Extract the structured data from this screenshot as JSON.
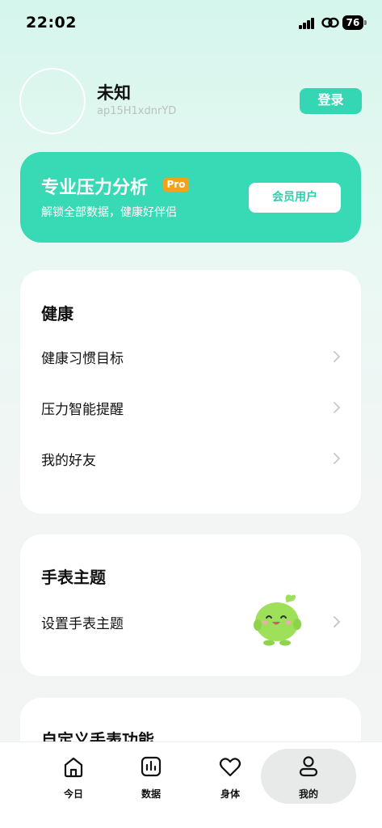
{
  "status_bar": {
    "time": "22:02",
    "battery": "76"
  },
  "profile": {
    "name": "未知",
    "user_id": "ap15H1xdnrYD",
    "login_label": "登录"
  },
  "pro_banner": {
    "title": "专业压力分析",
    "badge": "Pro",
    "subtitle": "解锁全部数据，健康好伴侣",
    "button_label": "会员用户"
  },
  "health_card": {
    "title": "健康",
    "items": [
      {
        "label": "健康习惯目标"
      },
      {
        "label": "压力智能提醒"
      },
      {
        "label": "我的好友"
      }
    ]
  },
  "watch_theme_card": {
    "title": "手表主题",
    "items": [
      {
        "label": "设置手表主题"
      }
    ]
  },
  "custom_card": {
    "title": "自定义手表功能"
  },
  "tab_bar": {
    "tabs": [
      {
        "label": "今日",
        "icon": "home-icon"
      },
      {
        "label": "数据",
        "icon": "chart-icon"
      },
      {
        "label": "身体",
        "icon": "heart-icon"
      },
      {
        "label": "我的",
        "icon": "person-icon"
      }
    ],
    "active": "我的"
  },
  "colors": {
    "accent": "#38dab6",
    "badge": "#f3a21c",
    "mascot": "#9ee05a"
  }
}
